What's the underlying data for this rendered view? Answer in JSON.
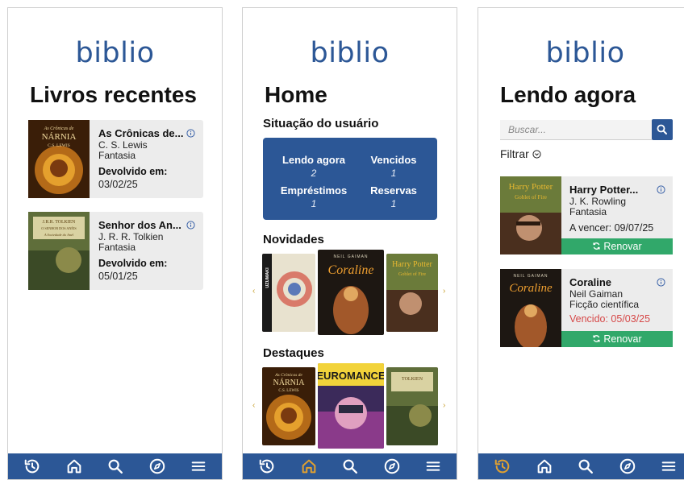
{
  "brand": {
    "logo": "biblio",
    "accent": "#2c5796",
    "success": "#31a86a",
    "danger": "#d64848"
  },
  "screen1": {
    "title": "Livros recentes",
    "books": [
      {
        "title": "As Crônicas de...",
        "author": "C. S. Lewis",
        "genre": "Fantasia",
        "returned_label": "Devolvido em:",
        "returned_date": "03/02/25",
        "cover_text_top": "As Crônicas de",
        "cover_text_main": "NÁRNIA",
        "cover_text_author": "C.S. LEWIS"
      },
      {
        "title": "Senhor dos An...",
        "author": "J. R. R. Tolkien",
        "genre": "Fantasia",
        "returned_label": "Devolvido em:",
        "returned_date": "05/01/25",
        "cover_text_main": "J.R.R. TOLKIEN",
        "cover_text_top": "O SENHOR DOS ANÉIS",
        "cover_text_sub": "A Sociedade do Anel"
      }
    ]
  },
  "screen2": {
    "title": "Home",
    "status_heading": "Situação do usuário",
    "stats": [
      {
        "label": "Lendo agora",
        "value": "2"
      },
      {
        "label": "Vencidos",
        "value": "1"
      },
      {
        "label": "Empréstimos",
        "value": "1"
      },
      {
        "label": "Reservas",
        "value": "1"
      }
    ],
    "new_heading": "Novidades",
    "new_covers": [
      {
        "text": "UZUMAKI"
      },
      {
        "text_top": "NEIL GAIMAN",
        "text_main": "Coraline"
      },
      {
        "text_main": "Harry Potter",
        "text_sub": "Goblet of Fire"
      }
    ],
    "featured_heading": "Destaques",
    "featured_covers": [
      {
        "text_top": "As Crônicas de",
        "text_main": "NÁRNIA",
        "text_author": "C.S. LEWIS"
      },
      {
        "text_main": "NEUROMANCER"
      },
      {
        "text_main": "TOLKIEN"
      }
    ],
    "arrow_left": "‹",
    "arrow_right": "›"
  },
  "screen3": {
    "title": "Lendo agora",
    "search_placeholder": "Buscar...",
    "filter_label": "Filtrar",
    "books": [
      {
        "title": "Harry Potter...",
        "author": "J. K. Rowling",
        "genre": "Fantasia",
        "due_text": "A vencer: 09/07/25",
        "renew_label": "Renovar",
        "cover_text_main": "Harry Potter",
        "cover_text_sub": "Goblet of Fire"
      },
      {
        "title": "Coraline",
        "author": "Neil Gaiman",
        "genre": "Ficção científica",
        "due_text": "Vencido: 05/03/25",
        "renew_label": "Renovar",
        "cover_text_top": "NEIL GAIMAN",
        "cover_text_main": "Coraline"
      }
    ]
  },
  "navbar": {
    "icons": [
      "history-icon",
      "home-icon",
      "search-icon",
      "compass-icon",
      "menu-icon"
    ],
    "active_color": "#e0a030",
    "inactive_color": "#ffffff"
  }
}
